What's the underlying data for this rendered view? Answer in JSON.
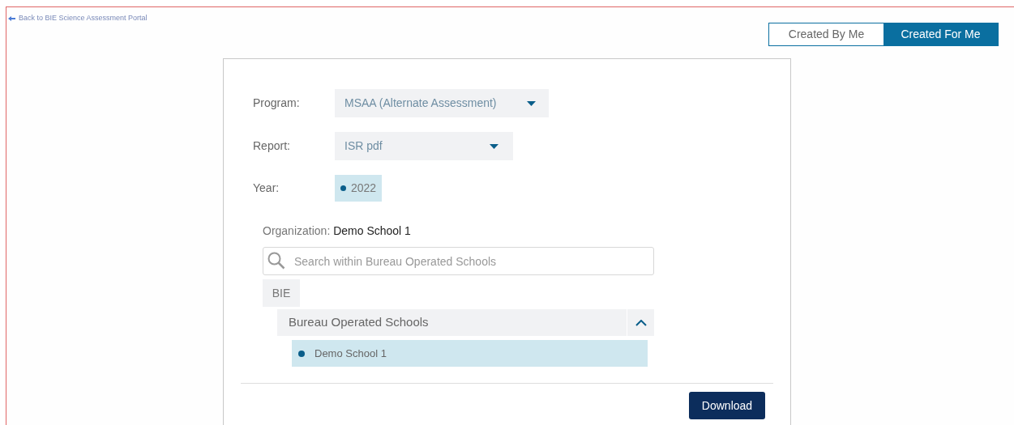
{
  "back_link": {
    "label": "Back to BIE Science Assessment Portal"
  },
  "tabs": [
    {
      "label": "Created By Me",
      "selected": false
    },
    {
      "label": "Created For Me",
      "selected": true
    }
  ],
  "form": {
    "program": {
      "label": "Program:",
      "value": "MSAA (Alternate Assessment)"
    },
    "report": {
      "label": "Report:",
      "value": "ISR pdf"
    },
    "year": {
      "label": "Year:",
      "options": [
        {
          "label": "2022",
          "selected": true
        }
      ]
    },
    "organization": {
      "label": "Organization:",
      "value": "Demo School 1"
    },
    "search": {
      "placeholder": "Search within Bureau Operated Schools"
    },
    "tree": [
      {
        "label": "BIE",
        "children": [
          {
            "label": "Bureau Operated Schools",
            "expanded": true,
            "children": [
              {
                "label": "Demo School 1",
                "selected": true
              }
            ]
          }
        ]
      }
    ]
  },
  "download_button": "Download"
}
